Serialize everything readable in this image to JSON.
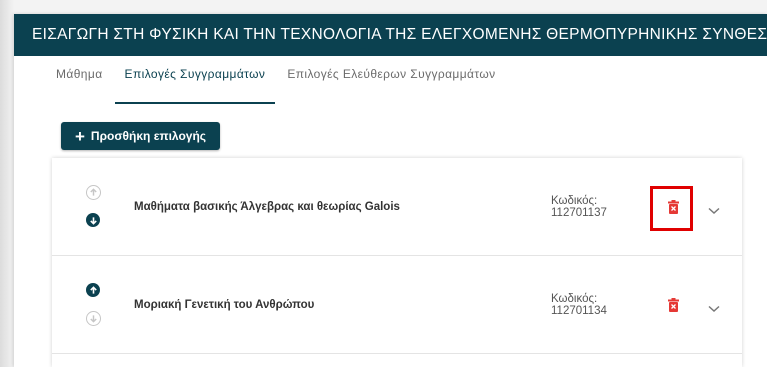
{
  "header": {
    "title": "ΕΙΣΑΓΩΓΗ ΣΤΗ ΦΥΣΙΚΗ ΚΑΙ ΤΗΝ ΤΕΧΝΟΛΟΓΙΑ ΤΗΣ ΕΛΕΓΧΟΜΕΝΗΣ ΘΕΡΜΟΠΥΡΗΝΙΚΗΣ ΣΥΝΘΕΣΗΣ"
  },
  "tabs": [
    {
      "label": "Μάθημα",
      "active": false
    },
    {
      "label": "Επιλογές Συγγραμμάτων",
      "active": true
    },
    {
      "label": "Επιλογές Ελεύθερων Συγγραμμάτων",
      "active": false
    }
  ],
  "add_button": {
    "label": "Προσθήκη επιλογής",
    "icon": "plus-icon"
  },
  "items": [
    {
      "title": "Μαθήματα βασικής Άλγεβρας και θεωρίας Galois",
      "code_label": "Κωδικός:",
      "code": "112701137",
      "up_enabled": false,
      "down_enabled": true,
      "delete_highlighted": true
    },
    {
      "title": "Μοριακή Γενετική του Ανθρώπου",
      "code_label": "Κωδικός:",
      "code": "112701134",
      "up_enabled": true,
      "down_enabled": false,
      "delete_highlighted": false
    }
  ],
  "colors": {
    "primary": "#0b4150",
    "delete": "#e53935",
    "highlight": "#e00000",
    "disabled": "#c6c6c6"
  },
  "icons": [
    "arrow-up-icon",
    "arrow-down-icon",
    "trash-icon",
    "chevron-down-icon"
  ]
}
